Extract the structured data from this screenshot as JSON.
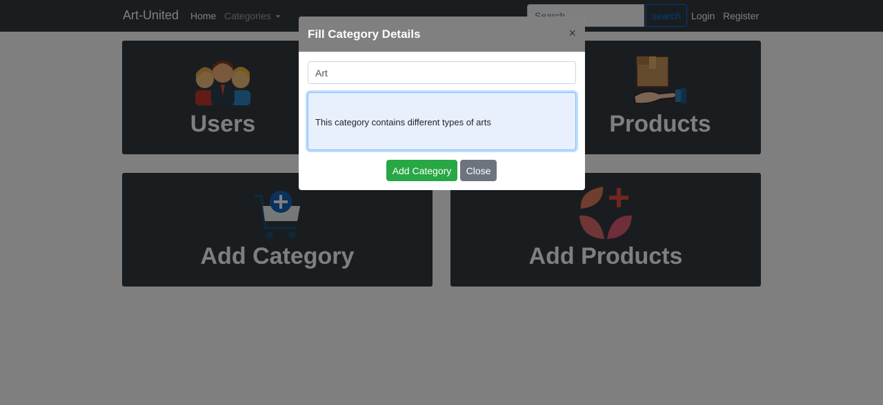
{
  "navbar": {
    "brand": "Art-United",
    "home": "Home",
    "categories": "Categories",
    "search_placeholder": "Search",
    "search_button": "search",
    "login": "Login",
    "register": "Register"
  },
  "cards": {
    "users": "Users",
    "products": "Products",
    "add_category": "Add Category",
    "add_products": "Add Products"
  },
  "modal": {
    "title": "Fill Category Details",
    "close_symbol": "×",
    "name_value": "Art",
    "description_value": "This category contains different types of arts",
    "add_button": "Add Category",
    "close_button": "Close"
  },
  "icons": {
    "users": "users-group-icon",
    "products": "box-in-hand-icon",
    "add_category": "cart-plus-icon",
    "add_products": "shapes-plus-icon"
  },
  "colors": {
    "navbar": "#343a40",
    "card": "#343a40",
    "modal_header": "#808080",
    "success": "#28a745",
    "secondary": "#6c757d",
    "primary": "#007bff"
  }
}
